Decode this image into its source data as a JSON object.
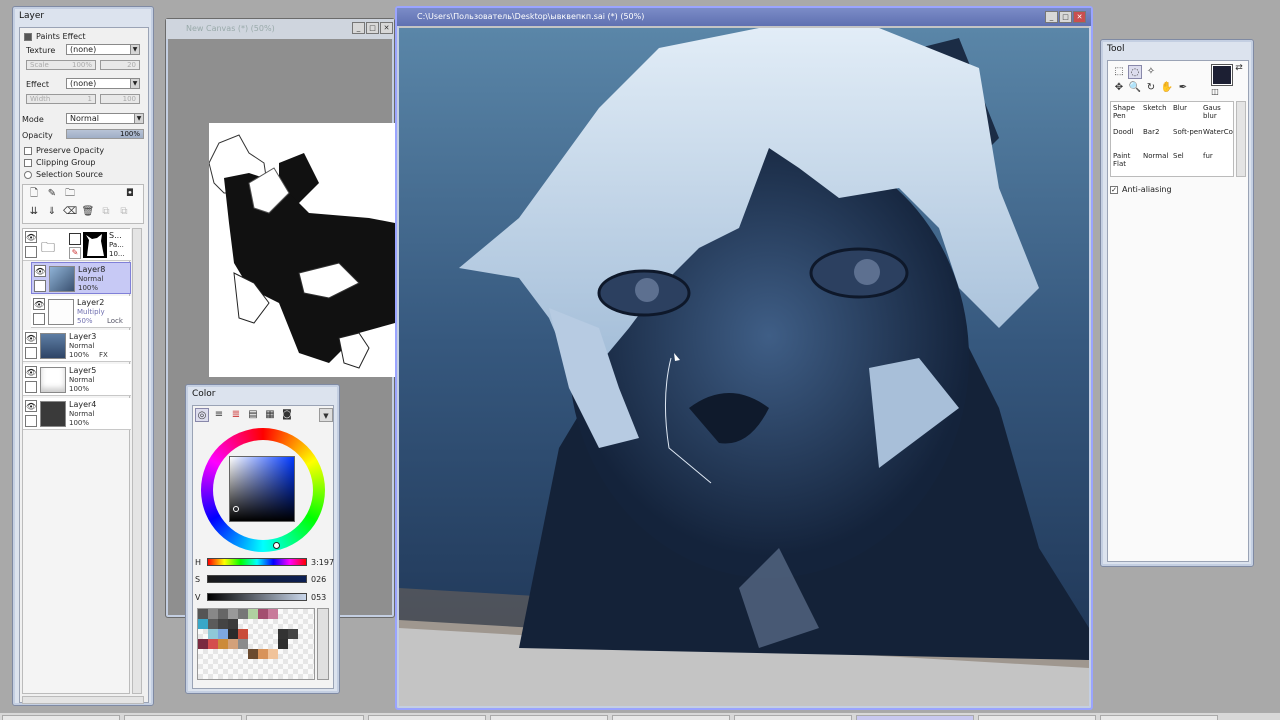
{
  "layer_panel": {
    "title": "Layer",
    "paints_effect": "Paints Effect",
    "texture_label": "Texture",
    "texture_value": "(none)",
    "scale_label": "Scale",
    "scale_value": "100%",
    "scale_value2": "20",
    "effect_label": "Effect",
    "effect_value": "(none)",
    "width_label": "Width",
    "width_value": "1",
    "width_value2": "100",
    "mode_label": "Mode",
    "mode_value": "Normal",
    "opacity_label": "Opacity",
    "opacity_value": "100%",
    "preserve_opacity": "Preserve Opacity",
    "clipping_group": "Clipping Group",
    "selection_source": "Selection Source",
    "layers": [
      {
        "name": "S...",
        "mode": "Pa...",
        "opacity": "10...",
        "type": "folder"
      },
      {
        "name": "Layer8",
        "mode": "Normal",
        "opacity": "100%",
        "selected": true
      },
      {
        "name": "Layer2",
        "mode": "Multiply",
        "opacity": "50%",
        "extra": "Lock"
      },
      {
        "name": "Layer3",
        "mode": "Normal",
        "opacity": "100%",
        "extra": "FX"
      },
      {
        "name": "Layer5",
        "mode": "Normal",
        "opacity": "100%"
      },
      {
        "name": "Layer4",
        "mode": "Normal",
        "opacity": "100%"
      }
    ]
  },
  "ref_window": {
    "title": "New Canvas (*) (50%)"
  },
  "main_window": {
    "title": "C:\\Users\\Пользователь\\Desktop\\ывквепкп.sai (*) (50%)"
  },
  "color_panel": {
    "title": "Color",
    "h_label": "H",
    "h_value": "3:197",
    "s_label": "S",
    "s_value": "026",
    "v_label": "V",
    "v_value": "053"
  },
  "tool_panel": {
    "title": "Tool",
    "tools": [
      {
        "l1": "Shape",
        "l2": "Pen"
      },
      {
        "l1": "Sketch",
        "l2": ""
      },
      {
        "l1": "Blur",
        "l2": ""
      },
      {
        "l1": "Gaus",
        "l2": "blur"
      },
      {
        "l1": "Doodl",
        "l2": ""
      },
      {
        "l1": "Bar2",
        "l2": ""
      },
      {
        "l1": "Soft-pen",
        "l2": ""
      },
      {
        "l1": "WaterCo",
        "l2": ""
      },
      {
        "l1": "Paint",
        "l2": "Flat"
      },
      {
        "l1": "Normal",
        "l2": ""
      },
      {
        "l1": "Sel",
        "l2": ""
      },
      {
        "l1": "fur",
        "l2": ""
      }
    ],
    "anti_aliasing": "Anti-aliasing"
  },
  "colors": {
    "accent": "#7b8cc7",
    "primary_color": "#1c1f33",
    "secondary_color": "#7f95b6"
  }
}
